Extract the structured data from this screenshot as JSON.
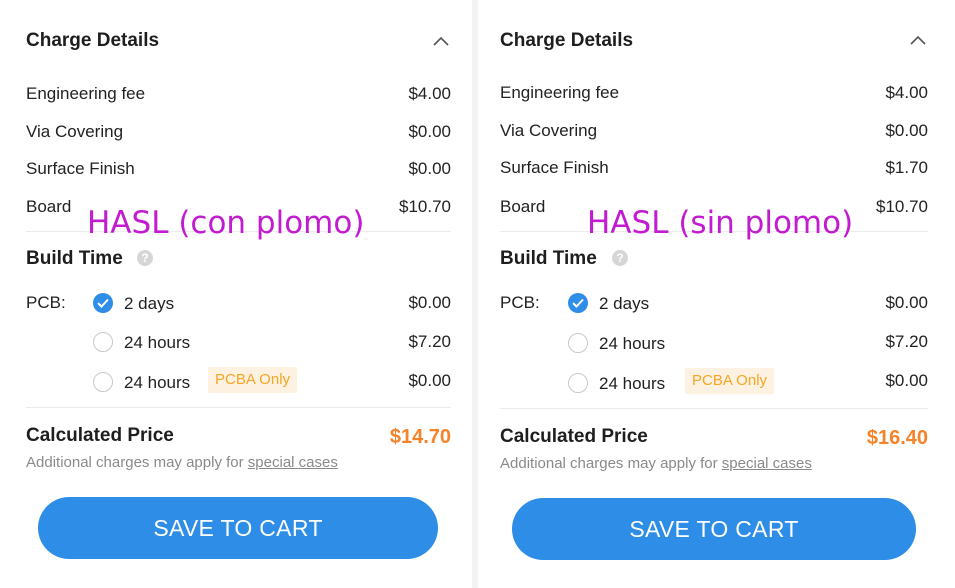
{
  "panels": [
    {
      "header": "Charge Details",
      "fees": [
        {
          "label": "Engineering fee",
          "price": "$4.00"
        },
        {
          "label": "Via Covering",
          "price": "$0.00"
        },
        {
          "label": "Surface Finish",
          "price": "$0.00"
        },
        {
          "label": "Board",
          "price": "$10.70"
        }
      ],
      "build_time_title": "Build Time",
      "pcb_label": "PCB:",
      "options": [
        {
          "label": "2 days",
          "price": "$0.00",
          "selected": true,
          "badge": ""
        },
        {
          "label": "24 hours",
          "price": "$7.20",
          "selected": false,
          "badge": ""
        },
        {
          "label": "24 hours",
          "price": "$0.00",
          "selected": false,
          "badge": "PCBA Only"
        }
      ],
      "calculated_price_label": "Calculated Price",
      "calculated_price": "$14.70",
      "note_text": "Additional charges may apply for",
      "note_link": "special cases",
      "save_button": "SAVE TO CART",
      "overlay_annotation": "HASL (con plomo)"
    },
    {
      "header": "Charge Details",
      "fees": [
        {
          "label": "Engineering fee",
          "price": "$4.00"
        },
        {
          "label": "Via Covering",
          "price": "$0.00"
        },
        {
          "label": "Surface Finish",
          "price": "$1.70"
        },
        {
          "label": "Board",
          "price": "$10.70"
        }
      ],
      "build_time_title": "Build Time",
      "pcb_label": "PCB:",
      "options": [
        {
          "label": "2 days",
          "price": "$0.00",
          "selected": true,
          "badge": ""
        },
        {
          "label": "24 hours",
          "price": "$7.20",
          "selected": false,
          "badge": ""
        },
        {
          "label": "24 hours",
          "price": "$0.00",
          "selected": false,
          "badge": "PCBA Only"
        }
      ],
      "calculated_price_label": "Calculated Price",
      "calculated_price": "$16.40",
      "note_text": "Additional charges may apply for",
      "note_link": "special cases",
      "save_button": "SAVE TO CART",
      "overlay_annotation": "HASL (sin plomo)"
    }
  ],
  "colors": {
    "accent": "#2e8de6",
    "price_highlight": "#f5832a",
    "badge_text": "#f5a623",
    "annotation": "#c21bd1"
  },
  "icons": {
    "collapse": "chevron-up-icon",
    "help": "help-circle-icon",
    "check": "check-icon"
  }
}
